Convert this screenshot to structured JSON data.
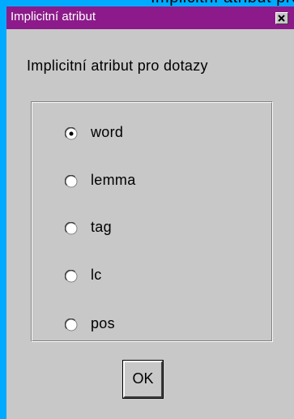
{
  "background_text": "Implicitní atribut pro dotazy",
  "window": {
    "title": "Implicitní atribut",
    "close_icon": "close-x-icon"
  },
  "dialog": {
    "prompt": "Implicitní atribut pro dotazy",
    "options": [
      {
        "label": "word",
        "selected": true
      },
      {
        "label": "lemma",
        "selected": false
      },
      {
        "label": "tag",
        "selected": false
      },
      {
        "label": "lc",
        "selected": false
      },
      {
        "label": "pos",
        "selected": false
      }
    ],
    "ok_label": "OK"
  },
  "colors": {
    "desktop": "#00aaff",
    "titlebar": "#8c1a8a",
    "window_face": "#c8c8c8"
  }
}
